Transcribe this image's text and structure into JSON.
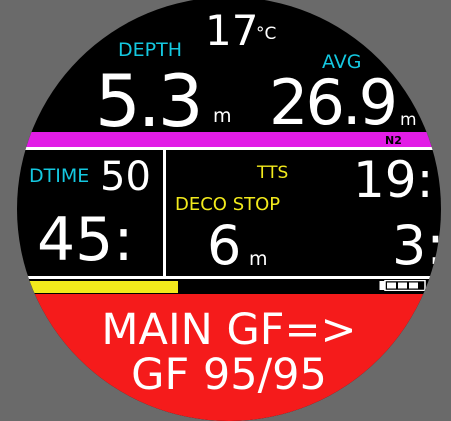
{
  "temperature": {
    "value": "17",
    "unit": "°C"
  },
  "depth": {
    "label": "DEPTH",
    "value": "5.3",
    "unit": "m"
  },
  "avg_depth": {
    "label": "AVG",
    "value": "26.9",
    "unit": "m"
  },
  "n2_bar": {
    "label": "N2",
    "color": "#e21de6"
  },
  "dive_time": {
    "label": "DTIME",
    "value": "50"
  },
  "ndl": {
    "value": "45:"
  },
  "tts": {
    "label": "TTS",
    "value": "19:"
  },
  "deco_stop": {
    "label": "DECO STOP",
    "depth": "6",
    "depth_unit": "m",
    "time": "3:"
  },
  "gas_bar": {
    "fill_fraction": 0.38,
    "color": "#f2ea1c"
  },
  "battery": {
    "icon": "battery-icon"
  },
  "alert": {
    "line1": "MAIN GF=>",
    "line2": "GF 95/95",
    "color": "#f51b1b"
  },
  "colors": {
    "label_cyan": "#14c8e0",
    "label_yellow": "#f2ea1c"
  }
}
